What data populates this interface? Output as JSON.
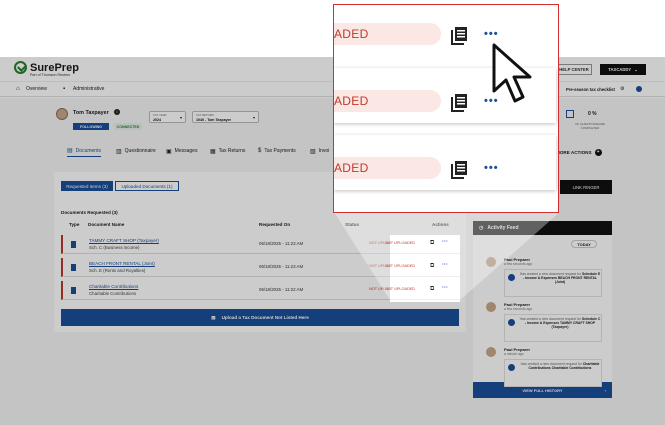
{
  "header": {
    "brand": "SurePrep",
    "brand_sub": "Part of Thomson Reuters",
    "help_center": "HELP CENTER",
    "taxcaddy": "TAXCADDY"
  },
  "nav": {
    "overview": "Overview",
    "administrative": "Administrative",
    "preseason": "Pre-season tax checklist"
  },
  "client": {
    "name": "Tom Taxpayer",
    "following": "FOLLOWING",
    "connected": "CONNECTED",
    "tax_year_label": "TAX YEAR",
    "tax_year": "2024",
    "tax_return_label": "TAX RETURN",
    "tax_return": "1040 - Tom Taxpayer",
    "percent": "0 %",
    "percent_label": "OF QUESTIONNAIRE COMPLETED"
  },
  "tabs": [
    "Documents",
    "Questionnaire",
    "Messages",
    "Tax Returns",
    "Tax Payments",
    "Invoi"
  ],
  "more_actions": "MORE ACTIONS",
  "link_ringer": "LINK RINGER",
  "subtabs": {
    "requested": "Requested Items (3)",
    "uploaded": "Uploaded Documents (1)"
  },
  "documents": {
    "section_title": "Documents Requested",
    "count": "(3)",
    "columns": {
      "type": "Type",
      "name": "Document Name",
      "requested_on": "Requested On",
      "status": "Status",
      "actions": "Actions"
    },
    "rows": [
      {
        "name": "TAMMY CRAFT SHOP (Taxpayer)",
        "sub": "Sch. C (Business income)",
        "date": "06/18/2025 - 11:23 AM",
        "status": "NOT UPLOADED"
      },
      {
        "name": "BEACH FRONT RENTAL (Joint)",
        "sub": "Sch. E (Rents and Royalties)",
        "date": "06/18/2025 - 11:23 AM",
        "status": "NOT UPLOADED"
      },
      {
        "name": "Charitable Contributions",
        "sub": "Charitable Contributions",
        "date": "06/18/2025 - 11:22 AM",
        "status": "NOT UPLOADED"
      }
    ],
    "upload_button": "Upload a Tax Document Not Listed Here"
  },
  "activity": {
    "title": "Activity Feed",
    "today": "TODAY",
    "items": [
      {
        "who": "Paul Preparer",
        "when": "a few seconds ago",
        "text": "Has created a new document request for",
        "bold": "Schedule E - Income & Expenses BEACH FRONT RENTAL (Joint)"
      },
      {
        "who": "Paul Preparer",
        "when": "a few seconds ago",
        "text": "Has created a new document request for",
        "bold": "Schedule C - Income & Expenses TAMMY CRAFT SHOP (Taxpayer)"
      },
      {
        "who": "Paul Preparer",
        "when": "a minute ago",
        "text": "Has created a new document request for",
        "bold": "Charitable Contributions Charitable Contributions"
      }
    ],
    "view_full": "VIEW FULL HISTORY"
  },
  "zoom": {
    "status_fragment": "ADED",
    "rows": 3
  }
}
